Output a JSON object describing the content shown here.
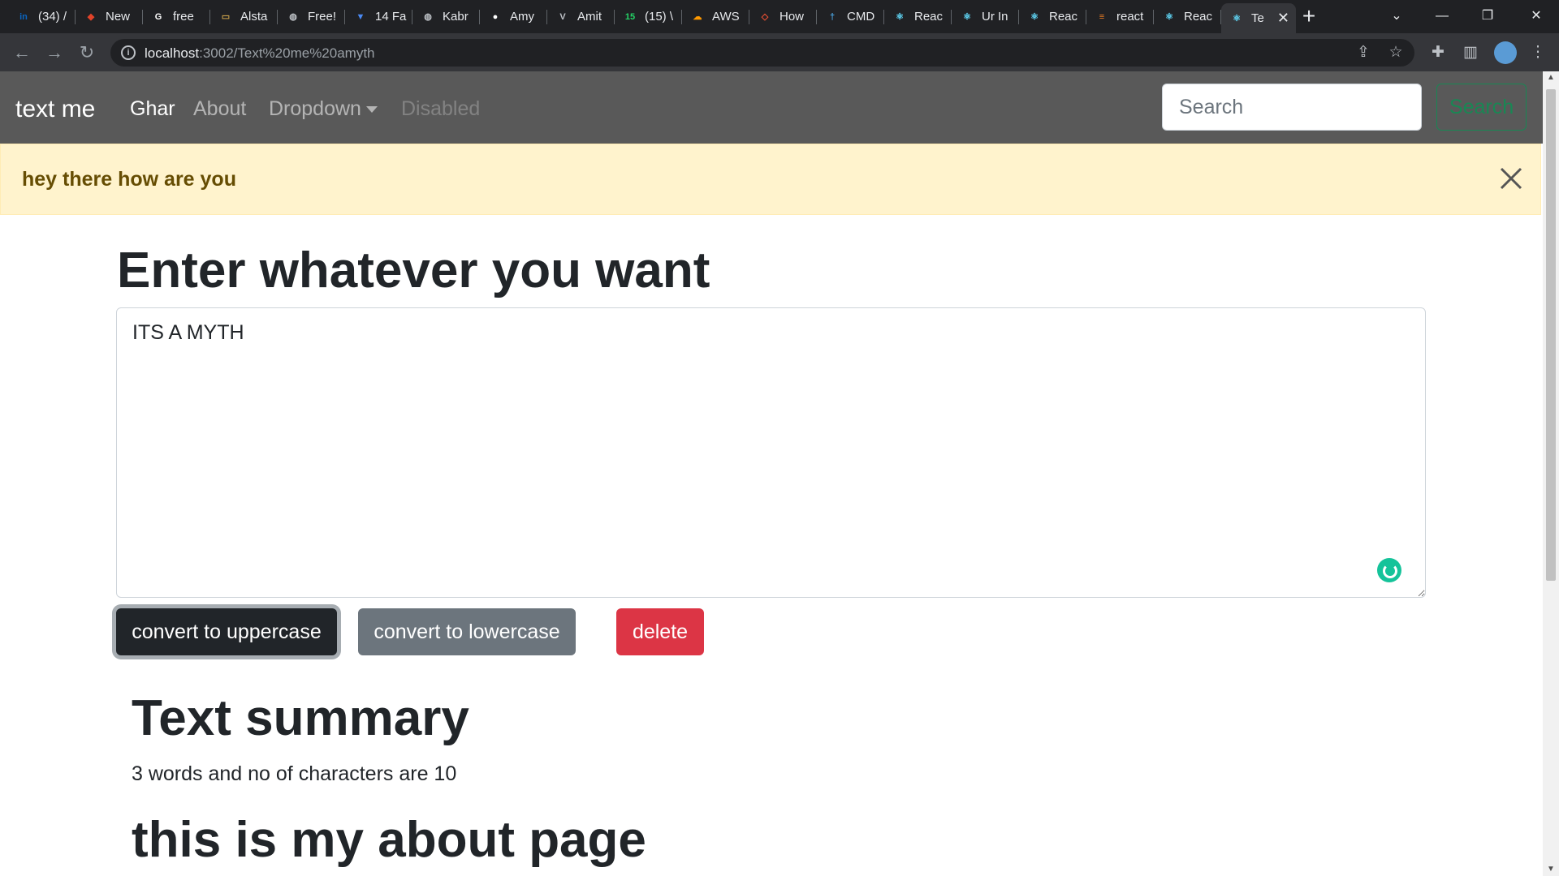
{
  "browser": {
    "tabs": [
      {
        "title": "(34) /",
        "icon": "linkedin-icon",
        "color": "#0a66c2",
        "glyph": "in"
      },
      {
        "title": "New",
        "icon": "gitlab-icon",
        "color": "#e24329",
        "glyph": "◆"
      },
      {
        "title": "free",
        "icon": "google-icon",
        "color": "#ffffff",
        "glyph": "G"
      },
      {
        "title": "Alsta",
        "icon": "card-icon",
        "color": "#c8a04a",
        "glyph": "▭"
      },
      {
        "title": "Free!",
        "icon": "globe-icon",
        "color": "#bdc1c6",
        "glyph": "◍"
      },
      {
        "title": "14 Fa",
        "icon": "bookmark-icon",
        "color": "#4a8af4",
        "glyph": "▼"
      },
      {
        "title": "Kabr",
        "icon": "globe-icon",
        "color": "#bdc1c6",
        "glyph": "◍"
      },
      {
        "title": "Amy",
        "icon": "github-icon",
        "color": "#ffffff",
        "glyph": "●"
      },
      {
        "title": "Amit",
        "icon": "vercel-icon",
        "color": "#bdc1c6",
        "glyph": "V"
      },
      {
        "title": "(15) \\",
        "icon": "whatsapp-icon",
        "color": "#25d366",
        "glyph": "15"
      },
      {
        "title": "AWS",
        "icon": "aws-icon",
        "color": "#ff9900",
        "glyph": "☁"
      },
      {
        "title": "How",
        "icon": "git-icon",
        "color": "#f05133",
        "glyph": "◇"
      },
      {
        "title": "CMD",
        "icon": "person-icon",
        "color": "#4aa3df",
        "glyph": "†"
      },
      {
        "title": "Reac",
        "icon": "react-icon",
        "color": "#61dafb",
        "glyph": "⚛"
      },
      {
        "title": "Ur In",
        "icon": "react-icon",
        "color": "#61dafb",
        "glyph": "⚛"
      },
      {
        "title": "Reac",
        "icon": "react-icon",
        "color": "#61dafb",
        "glyph": "⚛"
      },
      {
        "title": "react",
        "icon": "stackoverflow-icon",
        "color": "#f48024",
        "glyph": "≡"
      },
      {
        "title": "Reac",
        "icon": "react-icon",
        "color": "#61dafb",
        "glyph": "⚛"
      },
      {
        "title": "Te",
        "icon": "react-icon",
        "color": "#61dafb",
        "glyph": "⚛",
        "active": true
      }
    ],
    "url_host": "localhost",
    "url_path": ":3002/Text%20me%20amyth"
  },
  "navbar": {
    "brand": "text me",
    "links": [
      "Ghar",
      "About",
      "Dropdown",
      "Disabled"
    ],
    "search_placeholder": "Search",
    "search_button": "Search"
  },
  "alert": {
    "message": "hey there how are you"
  },
  "main": {
    "heading": "Enter whatever you want",
    "textarea_value": "ITS A MYTH",
    "buttons": {
      "uppercase": "convert to uppercase",
      "lowercase": "convert to lowercase",
      "delete": "delete"
    }
  },
  "summary": {
    "title": "Text summary",
    "text": "3 words and no of characters are 10"
  },
  "about": {
    "title": "this is my about page"
  }
}
